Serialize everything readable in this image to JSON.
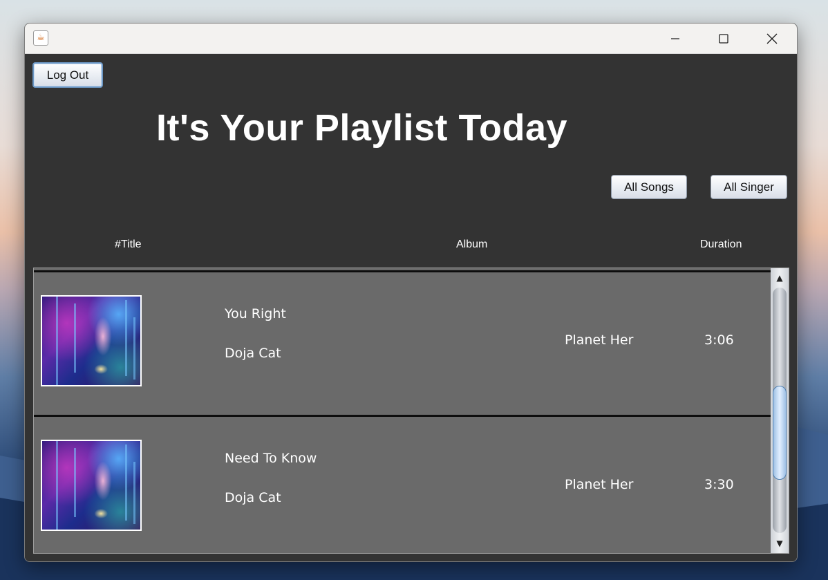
{
  "window": {
    "app_icon": "java-cup-icon",
    "controls": {
      "minimize": "minimize-icon",
      "maximize": "maximize-icon",
      "close": "close-icon"
    }
  },
  "header": {
    "logout_label": "Log Out",
    "title": "It's Your Playlist Today",
    "all_songs_label": "All Songs",
    "all_singer_label": "All Singer"
  },
  "columns": {
    "title": "#Title",
    "album": "Album",
    "duration": "Duration"
  },
  "songs": [
    {
      "title": "You Right",
      "artist": "Doja Cat",
      "album": "Planet Her",
      "duration": "3:06"
    },
    {
      "title": "Need To Know",
      "artist": "Doja Cat",
      "album": "Planet Her",
      "duration": "3:30"
    }
  ],
  "scrollbar": {
    "up_icon": "▲",
    "down_icon": "▼"
  },
  "colors": {
    "background": "#333333",
    "row_background": "#6a6a6a",
    "text": "#ffffff"
  }
}
